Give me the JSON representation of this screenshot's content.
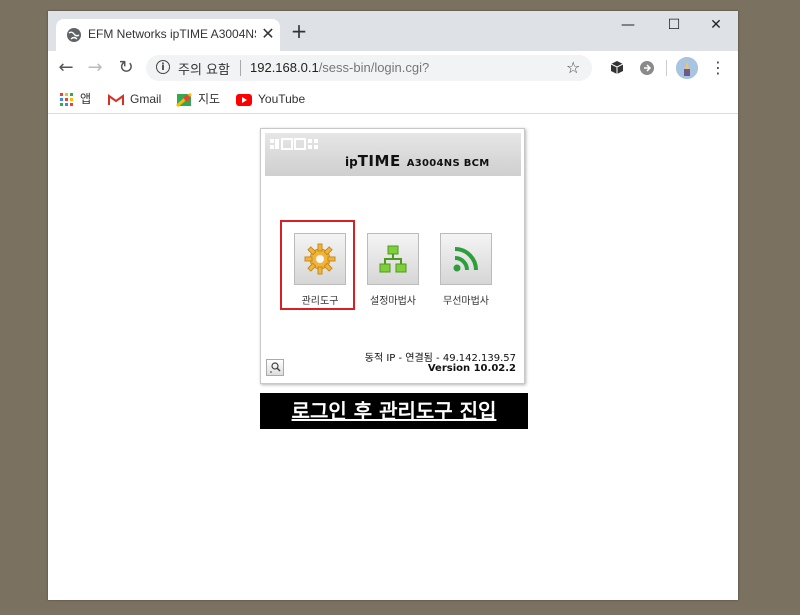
{
  "browser": {
    "tab_title": "EFM Networks ipTIME A3004NS",
    "new_tab_symbol": "+",
    "security_label": "주의 요함",
    "url_host": "192.168.0.1",
    "url_path": "/sess-bin/login.cgi?"
  },
  "bookmarks": [
    {
      "label": "앱",
      "icon": "apps-grid-icon"
    },
    {
      "label": "Gmail",
      "icon": "gmail-icon"
    },
    {
      "label": "지도",
      "icon": "maps-icon"
    },
    {
      "label": "YouTube",
      "icon": "youtube-icon"
    }
  ],
  "router": {
    "brand_ip": "ip",
    "brand_time": "TIME",
    "brand_model": "A3004NS BCM",
    "menu": [
      {
        "label": "관리도구",
        "icon": "gear-icon",
        "selected": true
      },
      {
        "label": "설정마법사",
        "icon": "network-wizard-icon"
      },
      {
        "label": "무선마법사",
        "icon": "wireless-icon"
      }
    ],
    "status": "동적 IP - 연결됨 - 49.142.139.57",
    "version": "Version 10.02.2"
  },
  "banner": "로그인 후 관리도구 진입",
  "colors": {
    "highlight": "#d81f26",
    "gear": "#f0b43c",
    "setup": "#7fcf3a",
    "wireless": "#2e9e3a"
  }
}
